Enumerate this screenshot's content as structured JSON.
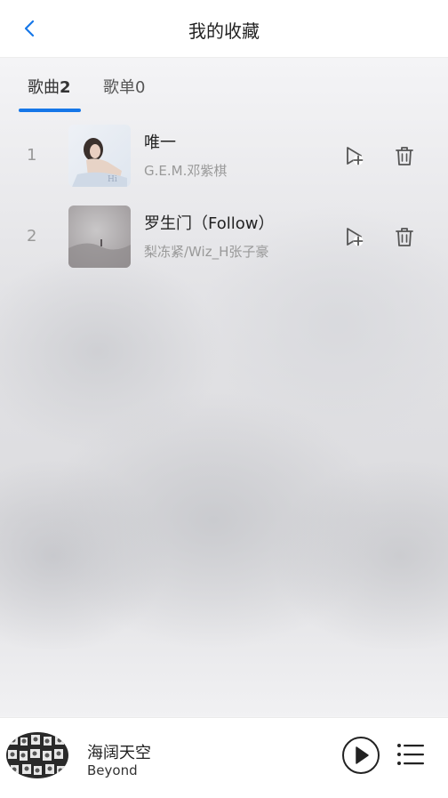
{
  "header": {
    "title": "我的收藏",
    "back_icon": "chevron-left-icon"
  },
  "tabs": [
    {
      "label": "歌曲",
      "count": "2",
      "active": true
    },
    {
      "label": "歌单",
      "count": "0",
      "active": false
    }
  ],
  "songs": [
    {
      "index": "1",
      "title": "唯一",
      "artist": "G.E.M.邓紫棋"
    },
    {
      "index": "2",
      "title": "罗生门（Follow）",
      "artist": "梨冻紧/Wiz_H张子豪"
    }
  ],
  "row_actions": {
    "add_icon": "add-to-playlist-icon",
    "delete_icon": "trash-icon"
  },
  "player": {
    "title": "海阔天空",
    "artist": "Beyond",
    "play_icon": "play-icon",
    "playlist_icon": "playlist-icon"
  },
  "colors": {
    "accent": "#1677e8",
    "primary_text": "#222222",
    "secondary_text": "#999999"
  }
}
